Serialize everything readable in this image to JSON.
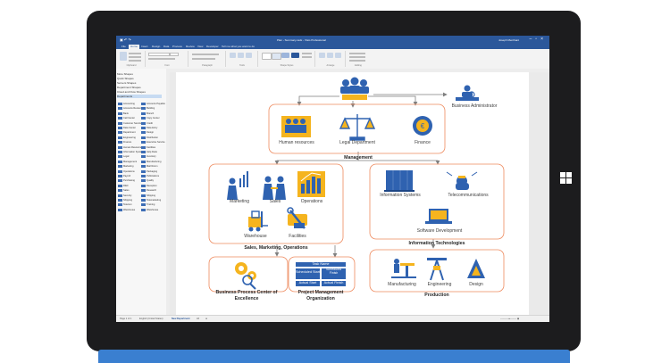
{
  "window": {
    "title": "Plan - Summary.vsdx - Visio Professional",
    "user": "Joseph Merchant"
  },
  "ribbon": {
    "tabs": [
      "File",
      "Home",
      "Insert",
      "Design",
      "Data",
      "Process",
      "Review",
      "View",
      "Developer",
      "Tell me what you want to do"
    ],
    "active_tab": "Home",
    "groups": [
      "Clipboard",
      "Font",
      "Paragraph",
      "Tools",
      "Shape Styles",
      "Arrange",
      "Editing"
    ]
  },
  "shapes_pane": {
    "stencils": [
      "More Shapes",
      "Quick Shapes",
      "Servers Shapes",
      "Department Shapes",
      "Cloud and Flow Shapes",
      "Departments"
    ],
    "selected": "Departments",
    "shapes_left": [
      "Accounting",
      "Accounts Receivable",
      "Bank",
      "Call Center",
      "Customer Service",
      "Data Center",
      "Department",
      "Engineering",
      "Finance",
      "Human Resources",
      "Information Systems",
      "Legal",
      "Management",
      "Marketing",
      "Operations",
      "Payroll",
      "Purchasing",
      "R&D",
      "Sales",
      "Security",
      "Shipping",
      "Telecom",
      "Warehouse"
    ],
    "shapes_right": [
      "Accounts Payable",
      "Building",
      "Branch",
      "Copy Center",
      "Credit",
      "Data Entry",
      "Design",
      "Distribution",
      "Executive Service",
      "Facilities",
      "Help Desk",
      "Inventory",
      "Manufacturing",
      "Mail Room",
      "Packaging",
      "Publications",
      "Quality",
      "Reception",
      "Research",
      "Shipping",
      "Telemarketing",
      "Training",
      "Warehouse"
    ]
  },
  "statusbar": {
    "page": "Page 1 of 1",
    "language": "English (United States)",
    "page_tab": "New Department",
    "tab_add": "All"
  },
  "diagram": {
    "administrator": "Business Administrator",
    "management": {
      "title": "Management",
      "items": [
        "Human resources",
        "Legal Department",
        "Finance"
      ]
    },
    "sales": {
      "title": "Sales, Marketing, Operations",
      "items": [
        "Marketing",
        "Sales",
        "Operations",
        "Warehouse",
        "Facilities"
      ]
    },
    "it": {
      "title": "Information Technologies",
      "items": [
        "Information Systems",
        "Telecommunications",
        "Software Development"
      ]
    },
    "bpce": {
      "title": "Business Process Center of Excellence"
    },
    "pmo": {
      "title": "Project Management Organization",
      "task": {
        "name": "Task Name",
        "scheduled_start": "Scheduled Start",
        "scheduled_finish": "Scheduled Finish",
        "actual_start": "Actual Start",
        "actual_finish": "Actual Finish"
      }
    },
    "production": {
      "title": "Production",
      "items": [
        "Manufacturing",
        "Engineering",
        "Design"
      ]
    }
  },
  "colors": {
    "accent": "#2b579a",
    "icon_blue": "#2f62b0",
    "icon_gold": "#f5b41e",
    "frame_orange": "#ee8a5e",
    "connector": "#7f7f7f"
  }
}
